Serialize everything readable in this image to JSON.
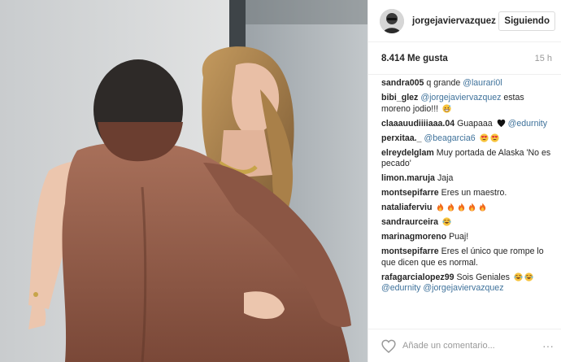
{
  "post": {
    "author": "jorgejaviervazquez",
    "follow_label": "Siguiendo",
    "likes": "8.414 Me gusta",
    "time": "15 h",
    "comment_placeholder": "Añade un comentario...",
    "more_label": "···"
  },
  "comments": [
    {
      "user": "sandra005",
      "parts": [
        {
          "t": "q grande "
        },
        {
          "m": "@laurari0l"
        }
      ]
    },
    {
      "user": "bibi_glez",
      "parts": [
        {
          "m": "@jorgejaviervazquez"
        },
        {
          "t": " estas moreno jodio!!! "
        },
        {
          "e": "grin-sweat"
        }
      ]
    },
    {
      "user": "claaauudiiiiaaa.04",
      "parts": [
        {
          "t": "Guapaaa "
        },
        {
          "e": "black-heart"
        },
        {
          "t": " "
        },
        {
          "m": "@edurnity"
        }
      ]
    },
    {
      "user": "perxitaa._",
      "parts": [
        {
          "m": "@beagarcia6"
        },
        {
          "t": " "
        },
        {
          "e": "heart-eyes"
        },
        {
          "e": "heart-eyes"
        }
      ]
    },
    {
      "user": "elreydelglam",
      "parts": [
        {
          "t": "Muy portada de Alaska 'No es pecado'"
        }
      ]
    },
    {
      "user": "limon.maruja",
      "parts": [
        {
          "t": "Jaja"
        }
      ]
    },
    {
      "user": "montsepifarre",
      "parts": [
        {
          "t": "Eres un maestro."
        }
      ]
    },
    {
      "user": "nataliaferviu",
      "parts": [
        {
          "e": "fire"
        },
        {
          "e": "fire"
        },
        {
          "e": "fire"
        },
        {
          "e": "fire"
        },
        {
          "e": "fire"
        }
      ]
    },
    {
      "user": "sandraurceira",
      "parts": [
        {
          "e": "laugh-tears"
        }
      ]
    },
    {
      "user": "marinagmoreno",
      "parts": [
        {
          "t": "Puaj!"
        }
      ]
    },
    {
      "user": "montsepifarre",
      "parts": [
        {
          "t": "Eres el único que rompe lo que dicen que es normal."
        }
      ]
    },
    {
      "user": "rafagarcialopez99",
      "parts": [
        {
          "t": "Sois Geniales "
        },
        {
          "e": "laugh-tears"
        },
        {
          "e": "laugh-tears"
        },
        {
          "t": " "
        },
        {
          "m": "@edurnity"
        },
        {
          "t": " "
        },
        {
          "m": "@jorgejaviervazquez"
        }
      ]
    }
  ],
  "icons": {
    "like": "heart-outline-icon",
    "more": "more-dots-icon",
    "avatar": "profile-avatar"
  },
  "colors": {
    "mention": "#3f729b",
    "text": "#262626",
    "muted": "#999999",
    "border": "#efefef"
  }
}
